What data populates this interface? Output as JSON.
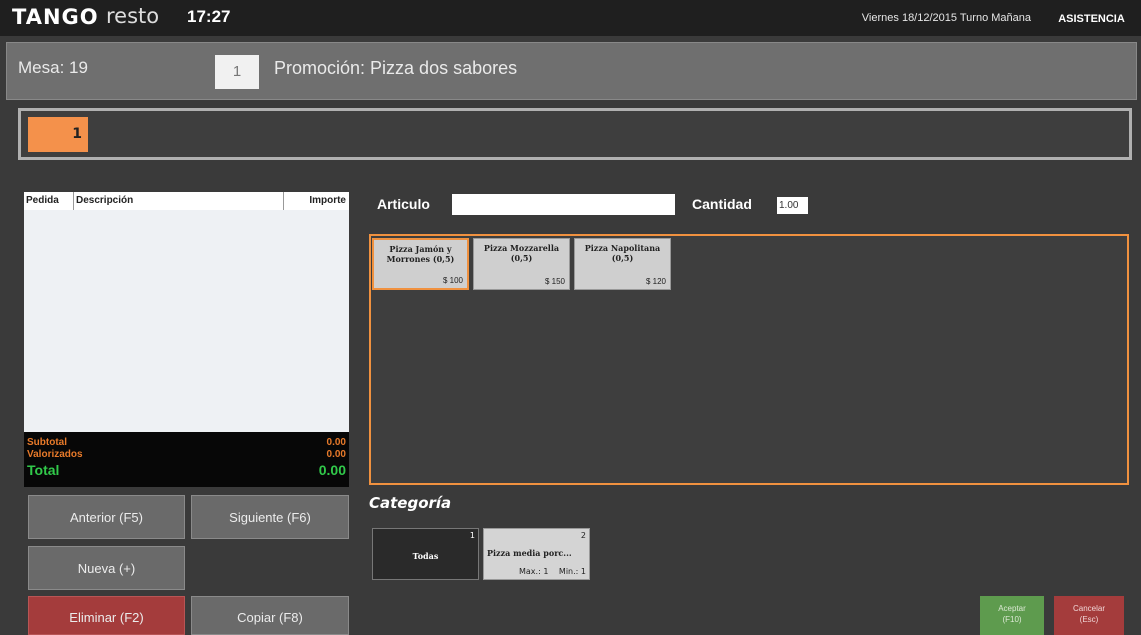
{
  "topbar": {
    "logo_bold": "TANGO",
    "logo_light": "resto",
    "clock": "17:27",
    "datetime": "Viernes 18/12/2015 Turno Mañana",
    "asistencia": "ASISTENCIA"
  },
  "mesa": {
    "label": "Mesa: 19",
    "qty": "1",
    "promo": "Promoción: Pizza dos sabores"
  },
  "steps": [
    {
      "label": "1"
    }
  ],
  "order": {
    "columns": [
      "Pedida",
      "Descripción",
      "Importe"
    ],
    "subtotal_label": "Subtotal",
    "subtotal_value": "0.00",
    "valorizados_label": "Valorizados",
    "valorizados_value": "0.00",
    "total_label": "Total",
    "total_value": "0.00"
  },
  "buttons": {
    "anterior": "Anterior (F5)",
    "siguiente": "Siguiente (F6)",
    "nueva": "Nueva (+)",
    "eliminar": "Eliminar (F2)",
    "copiar": "Copiar (F8)",
    "aceptar_line1": "Aceptar",
    "aceptar_line2": "(F10)",
    "cancelar_line1": "Cancelar",
    "cancelar_line2": "(Esc)"
  },
  "search": {
    "articulo_label": "Articulo",
    "articulo_value": "",
    "cantidad_label": "Cantidad",
    "cantidad_value": "1.00"
  },
  "products": [
    {
      "name": "Pizza Jamón y Morrones (0,5)",
      "price": "$ 100"
    },
    {
      "name": "Pizza Mozzarella (0,5)",
      "price": "$ 150"
    },
    {
      "name": "Pizza Napolitana (0,5)",
      "price": "$ 120"
    }
  ],
  "categoria": {
    "label": "Categoría",
    "items": [
      {
        "number": "1",
        "name": "Todas"
      },
      {
        "number": "2",
        "name": "Pizza media porc...",
        "max": "Max.: 1",
        "min": "Min.: 1"
      }
    ]
  },
  "colors": {
    "accent_orange": "#f0913f",
    "danger_red": "#a43c3c",
    "ok_green": "#5e9b4e",
    "total_green": "#31c94a"
  }
}
